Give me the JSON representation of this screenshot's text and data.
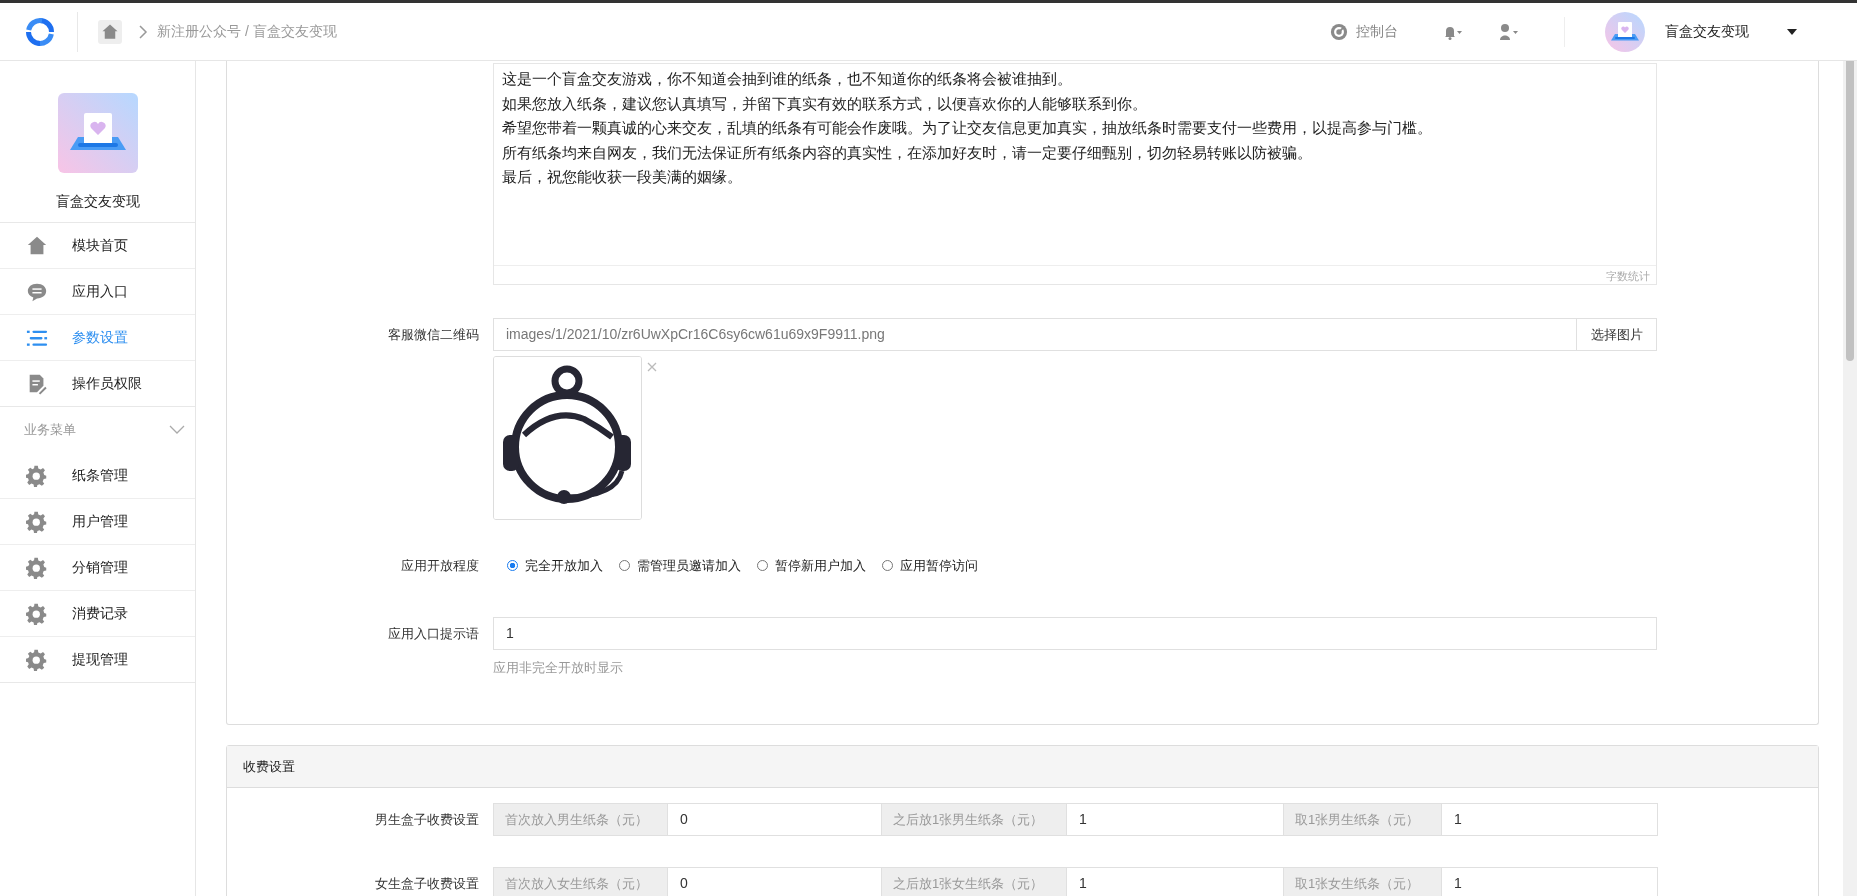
{
  "topbar": {
    "breadcrumb": "新注册公众号 / 盲盒交友变现",
    "console": "控制台",
    "user_name": "盲盒交友变现"
  },
  "sidebar": {
    "app_name": "盲盒交友变现",
    "items": [
      {
        "label": "模块首页",
        "kind": "home",
        "selected": false
      },
      {
        "label": "应用入口",
        "kind": "chat",
        "selected": false
      },
      {
        "label": "参数设置",
        "kind": "list",
        "selected": true
      },
      {
        "label": "操作员权限",
        "kind": "doc",
        "selected": false
      }
    ],
    "section": {
      "title": "业务菜单",
      "expanded": true,
      "items": [
        {
          "label": "纸条管理",
          "kind": "gear",
          "selected": false
        },
        {
          "label": "用户管理",
          "kind": "gear",
          "selected": false
        },
        {
          "label": "分销管理",
          "kind": "gear",
          "selected": false
        },
        {
          "label": "消费记录",
          "kind": "gear",
          "selected": false
        },
        {
          "label": "提现管理",
          "kind": "gear",
          "selected": false
        }
      ]
    }
  },
  "settings_panel": {
    "intro": {
      "lines": [
        "这是一个盲盒交友游戏，你不知道会抽到谁的纸条，也不知道你的纸条将会被谁抽到。",
        "如果您放入纸条，建议您认真填写，并留下真实有效的联系方式，以便喜欢你的人能够联系到你。",
        "希望您带着一颗真诚的心来交友，乱填的纸条有可能会作废哦。为了让交友信息更加真实，抽放纸条时需要支付一些费用，以提高参与门槛。",
        "所有纸条均来自网友，我们无法保证所有纸条内容的真实性，在添加好友时，请一定要仔细甄别，切勿轻易转账以防被骗。",
        "最后，祝您能收获一段美满的姻缘。"
      ],
      "counter": "字数统计"
    },
    "fields": [
      {
        "label": "客服微信二维码",
        "value": "images/1/2021/10/zr6UwXpCr16C6sy6cw61u69x9F9911.png",
        "button": "选择图片"
      },
      {
        "kind": "radio",
        "label": "应用开放程度",
        "options": [
          {
            "label": "完全开放加入",
            "selected": true
          },
          {
            "label": "需管理员邀请加入",
            "selected": false
          },
          {
            "label": "暂停新用户加入",
            "selected": false
          },
          {
            "label": "应用暂停访问",
            "selected": false
          }
        ]
      },
      {
        "kind": "text",
        "label": "应用入口提示语",
        "value": "1",
        "help": "应用非完全开放时显示"
      }
    ]
  },
  "fee_panel": {
    "title": "收费设置",
    "rows": [
      {
        "label": "男生盒子收费设置",
        "inputs": [
          {
            "addon": "首次放入男生纸条（元）",
            "value": "0"
          },
          {
            "addon": "之后放1张男生纸条（元）",
            "value": "1"
          },
          {
            "addon": "取1张男生纸条（元）",
            "value": "1"
          }
        ]
      },
      {
        "label": "女生盒子收费设置",
        "inputs": [
          {
            "addon": "首次放入女生纸条（元）",
            "value": "0"
          },
          {
            "addon": "之后放1张女生纸条（元）",
            "value": "1"
          },
          {
            "addon": "取1张女生纸条（元）",
            "value": "1"
          }
        ]
      }
    ]
  }
}
